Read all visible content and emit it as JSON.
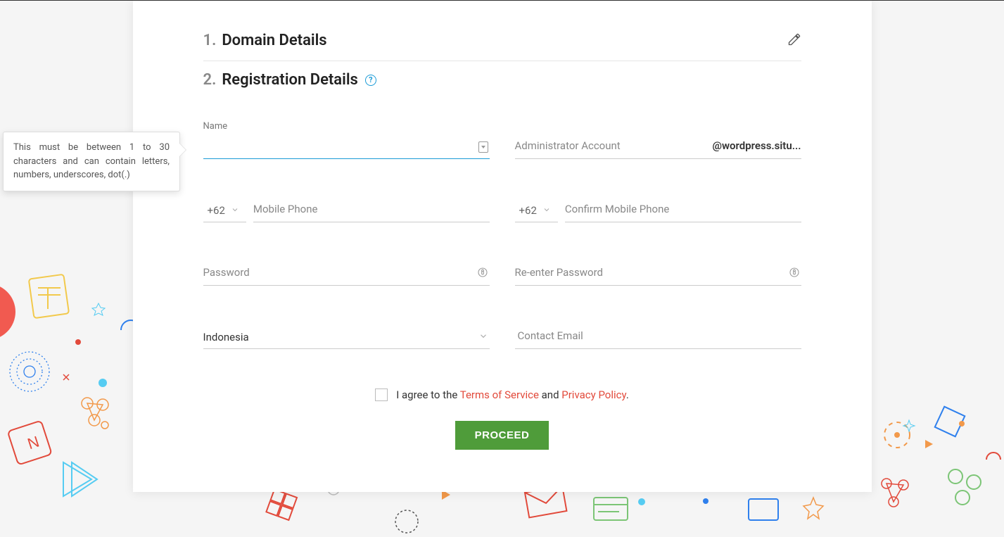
{
  "steps": {
    "domain": {
      "num": "1.",
      "title": "Domain Details"
    },
    "registration": {
      "num": "2.",
      "title": "Registration Details"
    }
  },
  "tooltip": {
    "text": "This must be between 1 to 30 characters and can contain letters, numbers, underscores, dot(.)"
  },
  "form": {
    "name": {
      "label": "Name"
    },
    "admin": {
      "label": "Administrator Account",
      "domain_suffix": "@wordpress.situ..."
    },
    "phone": {
      "prefix": "+62",
      "label": "Mobile Phone"
    },
    "confirm_phone": {
      "prefix": "+62",
      "label": "Confirm Mobile Phone"
    },
    "password": {
      "label": "Password"
    },
    "reenter_password": {
      "label": "Re-enter Password"
    },
    "country": {
      "value": "Indonesia"
    },
    "contact_email": {
      "label": "Contact Email"
    }
  },
  "consent": {
    "prefix": "I agree to the ",
    "tos": "Terms of Service",
    "mid": " and ",
    "pp": "Privacy Policy",
    "suffix": "."
  },
  "actions": {
    "proceed": "PROCEED"
  }
}
